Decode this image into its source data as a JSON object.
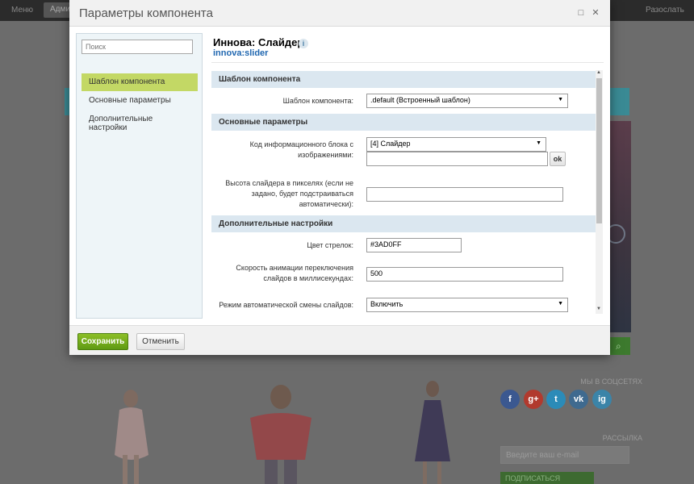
{
  "background": {
    "topbar_items": [
      "Меню",
      "Адми",
      "Разослать"
    ],
    "social_label": "МЫ В СОЦСЕТЯХ",
    "newsletter_label": "РАССЫЛКА",
    "email_placeholder": "Введите ваш e-mail",
    "subscribe_label": "ПОДПИСАТЬСЯ",
    "social_icons": [
      "f",
      "g+",
      "t",
      "vk",
      "ig"
    ],
    "search_icon": "search-icon"
  },
  "modal": {
    "title": "Параметры компонента",
    "window_buttons": [
      "maximize-icon",
      "close-icon"
    ]
  },
  "left": {
    "search_placeholder": "Поиск",
    "nav": [
      {
        "label": "Шаблон компонента",
        "active": true
      },
      {
        "label": "Основные параметры",
        "active": false
      },
      {
        "label": "Дополнительные настройки",
        "active": false
      }
    ]
  },
  "component": {
    "title": "Иннова: Слайдер",
    "code": "innova:slider"
  },
  "form": {
    "sections": [
      {
        "title": "Шаблон компонента",
        "fields": [
          {
            "label": "Шаблон компонента:",
            "type": "select",
            "value": ".default (Встроенный шаблон)"
          }
        ]
      },
      {
        "title": "Основные параметры",
        "fields": [
          {
            "label": "Код информационного блока с изображениями:",
            "type": "select",
            "value": "[4] Слайдер",
            "extra_input": "",
            "ok_label": "ok"
          },
          {
            "label": "Высота слайдера в пикселях (если не задано, будет подстраиваться автоматически):",
            "type": "text",
            "value": ""
          }
        ]
      },
      {
        "title": "Дополнительные настройки",
        "fields": [
          {
            "label": "Цвет стрелок:",
            "type": "text",
            "value": "#3AD0FF"
          },
          {
            "label": "Скорость анимации переключения слайдов в миллисекундах:",
            "type": "text",
            "value": "500"
          },
          {
            "label": "Режим автоматической смены слайдов:",
            "type": "select",
            "value": "Включить"
          }
        ]
      }
    ]
  },
  "footer": {
    "save_label": "Сохранить",
    "cancel_label": "Отменить"
  },
  "colors": {
    "accent_green": "#6aa81b",
    "nav_active": "#c3d865",
    "section_bg": "#dbe7f0",
    "link_blue": "#2067b0"
  }
}
